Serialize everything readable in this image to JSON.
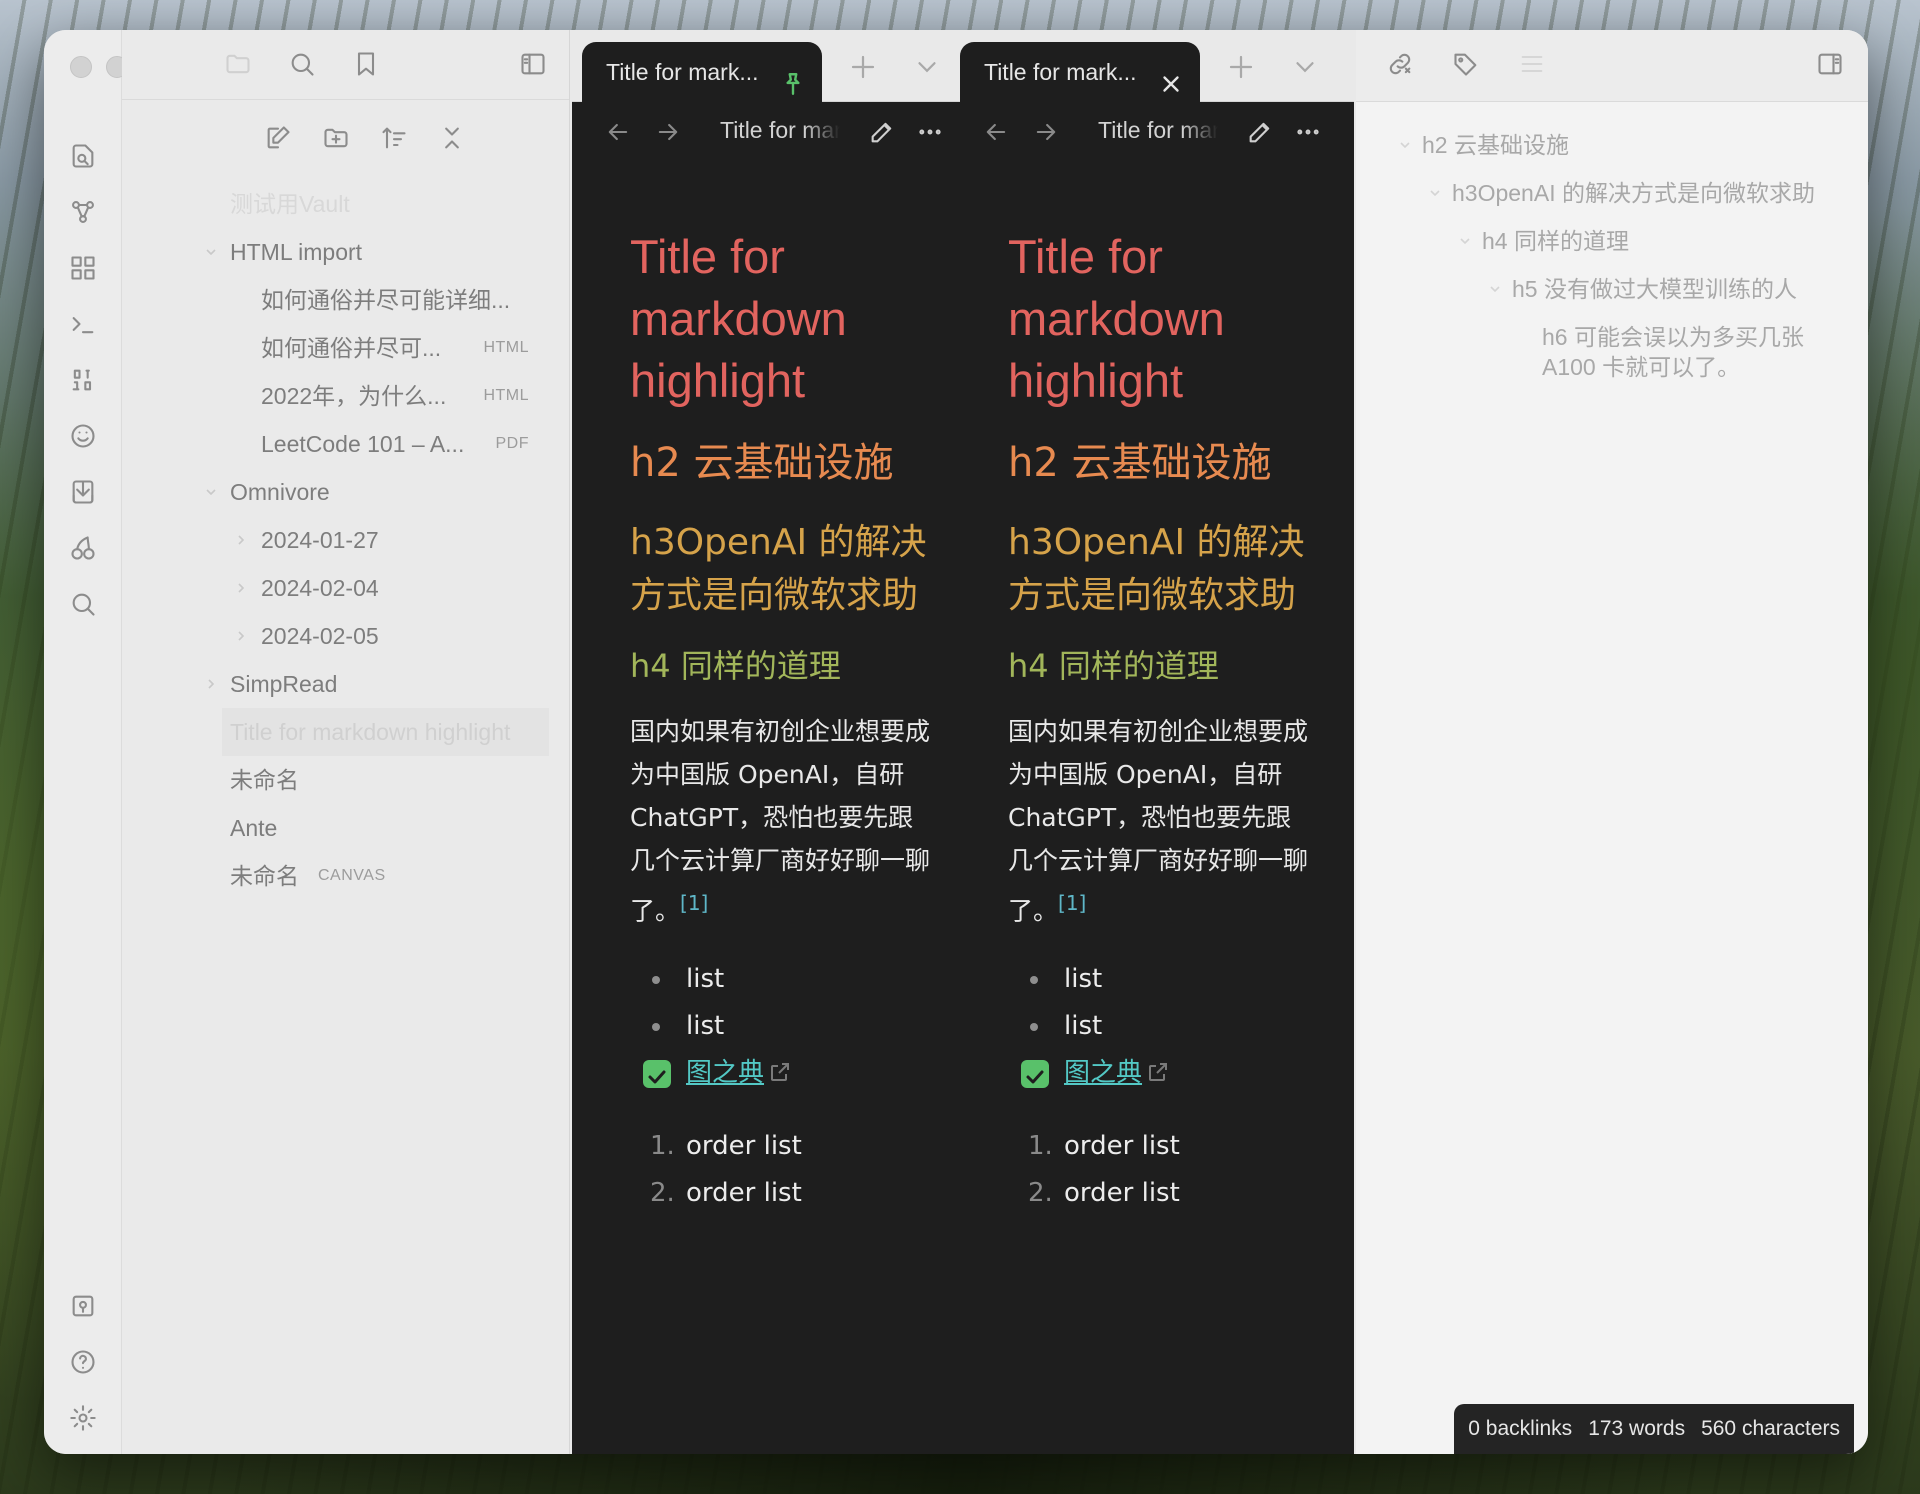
{
  "left_sidebar": {
    "vault_name": "测试用Vault",
    "tree": [
      {
        "label": "HTML import",
        "type": "folder",
        "expanded": true
      },
      {
        "label": "如何通俗并尽可能详细...",
        "type": "file",
        "tag": ""
      },
      {
        "label": "如何通俗并尽可...",
        "type": "file",
        "tag": "HTML"
      },
      {
        "label": "2022年，为什么...",
        "type": "file",
        "tag": "HTML"
      },
      {
        "label": "LeetCode 101 – A...",
        "type": "file",
        "tag": "PDF"
      },
      {
        "label": "Omnivore",
        "type": "folder",
        "expanded": true
      },
      {
        "label": "2024-01-27",
        "type": "folder",
        "expanded": false
      },
      {
        "label": "2024-02-04",
        "type": "folder",
        "expanded": false
      },
      {
        "label": "2024-02-05",
        "type": "folder",
        "expanded": false
      },
      {
        "label": "SimpRead",
        "type": "folder",
        "expanded": false
      },
      {
        "label": "Title for markdown highlight",
        "type": "file",
        "active": true
      },
      {
        "label": "未命名",
        "type": "file"
      },
      {
        "label": "Ante",
        "type": "file"
      },
      {
        "label": "未命名",
        "type": "file",
        "tag": "CANVAS"
      }
    ]
  },
  "panes": [
    {
      "tab_title": "Title for mark...",
      "tab_button": "pin-icon",
      "view_title": "Title for markdown highlight",
      "doc": {
        "h1": "Title for markdown highlight",
        "h2": "h2 云基础设施",
        "h3": "h3OpenAI 的解决方式是向微软求助",
        "h4": "h4 同样的道理",
        "paragraph": "国内如果有初创企业想要成为中国版 OpenAI，自研 ChatGPT，恐怕也要先跟几个云计算厂商好好聊一聊了。",
        "footnote": "[1]",
        "list": [
          "list",
          "list"
        ],
        "task_link": "图之典",
        "ordered": [
          "order list",
          "order list"
        ],
        "ordered_nums": [
          "1.",
          "2."
        ]
      }
    },
    {
      "tab_title": "Title for mark...",
      "tab_button": "close-icon",
      "view_title": "Title for markdown highlight",
      "doc": {
        "h1": "Title for markdown highlight",
        "h2": "h2 云基础设施",
        "h3": "h3OpenAI 的解决方式是向微软求助",
        "h4": "h4 同样的道理",
        "paragraph": "国内如果有初创企业想要成为中国版 OpenAI，自研 ChatGPT，恐怕也要先跟几个云计算厂商好好聊一聊了。",
        "footnote": "[1]",
        "list": [
          "list",
          "list"
        ],
        "task_link": "图之典",
        "ordered": [
          "order list",
          "order list"
        ],
        "ordered_nums": [
          "1.",
          "2."
        ]
      }
    }
  ],
  "outline": [
    {
      "label": "h2 云基础设施",
      "level": 2
    },
    {
      "label": "h3OpenAI 的解决方式是向微软求助",
      "level": 3
    },
    {
      "label": "h4 同样的道理",
      "level": 4
    },
    {
      "label": "h5 没有做过大模型训练的人",
      "level": 5
    },
    {
      "label": "h6 可能会误以为多买几张 A100 卡就可以了。",
      "level": 6
    }
  ],
  "status_bar": {
    "backlinks": "0 backlinks",
    "words": "173 words",
    "characters": "560 characters"
  },
  "colors": {
    "h1": "#e2645f",
    "h2": "#e78a50",
    "h3": "#d6a34a",
    "h4": "#a2b65a",
    "link": "#53c8c5",
    "checkbox": "#59c16a",
    "pin": "#59c16a"
  }
}
